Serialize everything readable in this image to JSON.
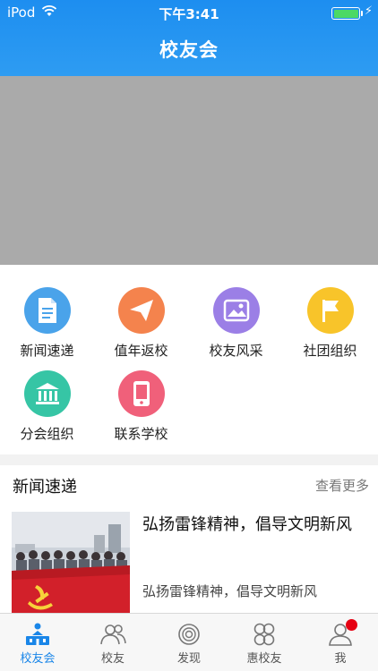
{
  "status_bar": {
    "carrier": "iPod",
    "time": "下午3:41"
  },
  "nav": {
    "title": "校友会"
  },
  "grid": [
    {
      "label": "新闻速递",
      "icon": "document-icon",
      "color": "#4aa3ea"
    },
    {
      "label": "值年返校",
      "icon": "paper-plane-icon",
      "color": "#f4834d"
    },
    {
      "label": "校友风采",
      "icon": "picture-icon",
      "color": "#9b7fe6"
    },
    {
      "label": "社团组织",
      "icon": "flag-icon",
      "color": "#f8c42a"
    },
    {
      "label": "分会组织",
      "icon": "building-icon",
      "color": "#36c5a5"
    },
    {
      "label": "联系学校",
      "icon": "phone-icon",
      "color": "#f0607a"
    }
  ],
  "news": {
    "section_title": "新闻速递",
    "more_label": "查看更多",
    "items": [
      {
        "headline": "弘扬雷锋精神，倡导文明新风",
        "summary": "弘扬雷锋精神，倡导文明新风"
      }
    ]
  },
  "tabbar": {
    "active_color": "#1a86e8",
    "items": [
      {
        "label": "校友会",
        "icon": "alumni-home-icon",
        "active": true
      },
      {
        "label": "校友",
        "icon": "people-icon",
        "active": false
      },
      {
        "label": "发现",
        "icon": "discover-icon",
        "active": false
      },
      {
        "label": "惠校友",
        "icon": "clover-icon",
        "active": false
      },
      {
        "label": "我",
        "icon": "user-icon",
        "active": false,
        "badge": true
      }
    ]
  }
}
